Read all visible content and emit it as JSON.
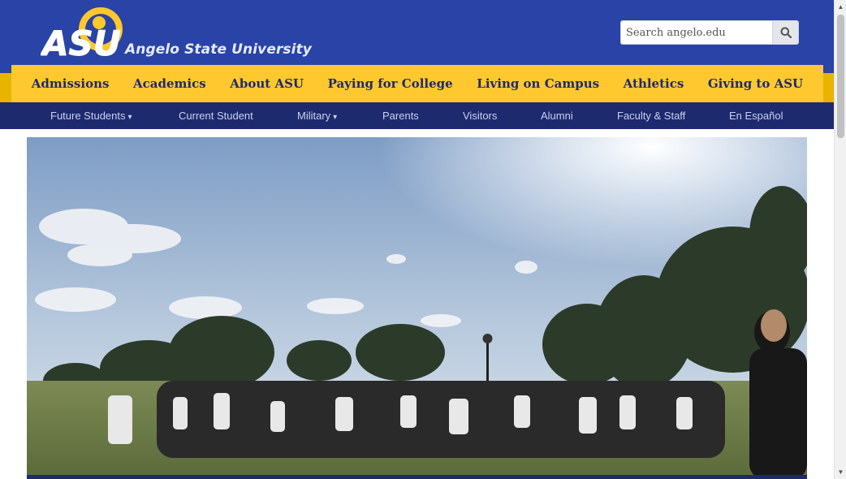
{
  "header": {
    "logo_text": "ASU",
    "university_name": "Angelo State University",
    "search_placeholder": "Search angelo.edu"
  },
  "primary_nav": [
    {
      "label": "Admissions"
    },
    {
      "label": "Academics"
    },
    {
      "label": "About ASU"
    },
    {
      "label": "Paying for College"
    },
    {
      "label": "Living on Campus"
    },
    {
      "label": "Athletics"
    },
    {
      "label": "Giving to ASU"
    }
  ],
  "secondary_nav": [
    {
      "label": "Future Students",
      "caret": "▾"
    },
    {
      "label": "Current Student",
      "caret": ""
    },
    {
      "label": "Military",
      "caret": "▾"
    },
    {
      "label": "Parents",
      "caret": ""
    },
    {
      "label": "Visitors",
      "caret": ""
    },
    {
      "label": "Alumni",
      "caret": ""
    },
    {
      "label": "Faculty & Staff",
      "caret": ""
    },
    {
      "label": "En Español",
      "caret": ""
    }
  ],
  "hero": {
    "image_alt": "Students gathered outdoors on campus lawn"
  },
  "colors": {
    "header_blue": "#2a43a6",
    "gold": "#ffc82e",
    "navy": "#1e2a6e"
  },
  "icons": {
    "search": "search-icon",
    "logo": "asu-logo"
  }
}
